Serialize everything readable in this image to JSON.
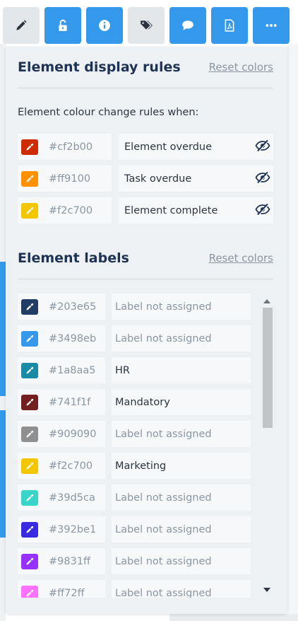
{
  "toolbar": {
    "buttons": [
      {
        "name": "pencil-icon",
        "active": false
      },
      {
        "name": "unlock-icon",
        "active": true
      },
      {
        "name": "info-icon",
        "active": true
      },
      {
        "name": "tags-icon",
        "active": false
      },
      {
        "name": "comment-icon",
        "active": true
      },
      {
        "name": "pdf-icon",
        "active": true
      },
      {
        "name": "more-icon",
        "active": true
      }
    ]
  },
  "display_rules": {
    "title": "Element display rules",
    "reset_label": "Reset colors",
    "caption": "Element colour change rules when:",
    "rules": [
      {
        "color": "#cf2b00",
        "hex": "#cf2b00",
        "label": "Element overdue"
      },
      {
        "color": "#ff9100",
        "hex": "#ff9100",
        "label": "Task overdue"
      },
      {
        "color": "#f2c700",
        "hex": "#f2c700",
        "label": "Element complete"
      }
    ]
  },
  "element_labels": {
    "title": "Element labels",
    "reset_label": "Reset colors",
    "items": [
      {
        "color": "#203e65",
        "hex": "#203e65",
        "label": "Label not assigned",
        "assigned": false
      },
      {
        "color": "#3498eb",
        "hex": "#3498eb",
        "label": "Label not assigned",
        "assigned": false
      },
      {
        "color": "#1a8aa5",
        "hex": "#1a8aa5",
        "label": "HR",
        "assigned": true
      },
      {
        "color": "#741f1f",
        "hex": "#741f1f",
        "label": "Mandatory",
        "assigned": true
      },
      {
        "color": "#909090",
        "hex": "#909090",
        "label": "Label not assigned",
        "assigned": false
      },
      {
        "color": "#f2c700",
        "hex": "#f2c700",
        "label": "Marketing",
        "assigned": true
      },
      {
        "color": "#39d5ca",
        "hex": "#39d5ca",
        "label": "Label not assigned",
        "assigned": false
      },
      {
        "color": "#392be1",
        "hex": "#392be1",
        "label": "Label not assigned",
        "assigned": false
      },
      {
        "color": "#9831ff",
        "hex": "#9831ff",
        "label": "Label not assigned",
        "assigned": false
      },
      {
        "color": "#ff72ff",
        "hex": "#ff72ff",
        "label": "Label not assigned",
        "assigned": false
      }
    ]
  }
}
